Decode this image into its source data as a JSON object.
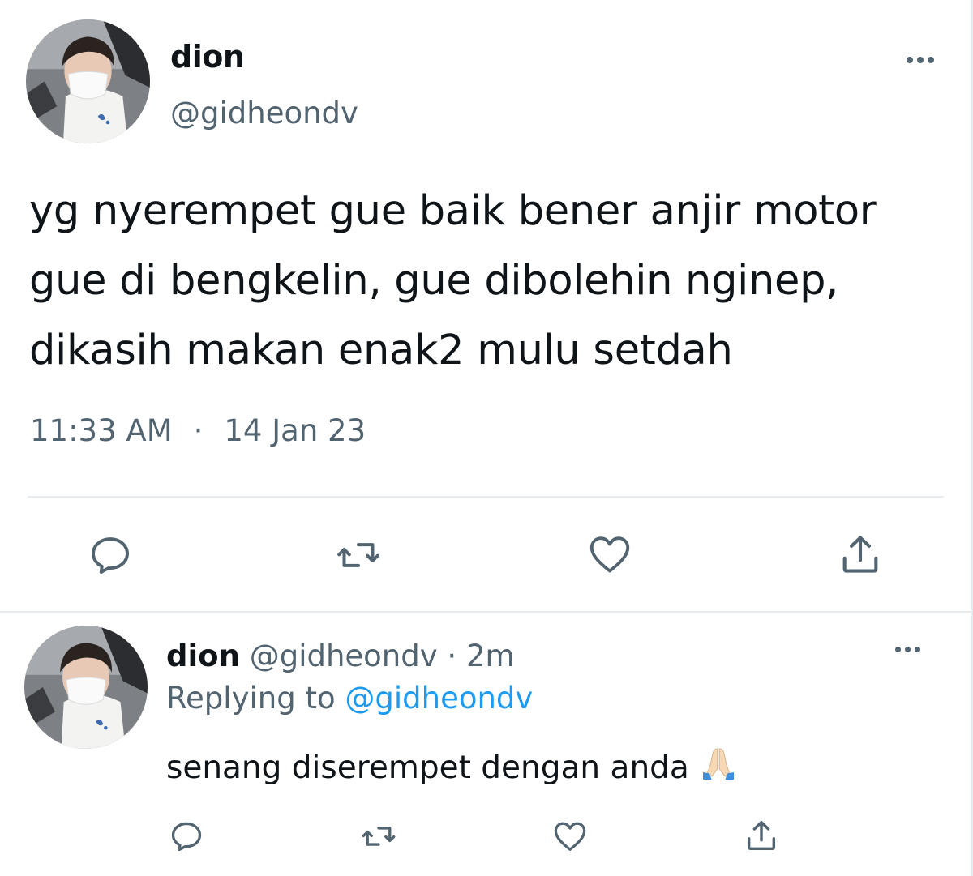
{
  "main_tweet": {
    "author_name": "dion",
    "author_handle": "@gidheondv",
    "text": "yg nyerempet gue baik bener anjir motor gue di bengkelin, gue dibolehin nginep, dikasih makan enak2 mulu setdah",
    "time": "11:33 AM",
    "separator": "·",
    "date": "14 Jan 23"
  },
  "reply": {
    "author_name": "dion",
    "author_handle": "@gidheondv",
    "separator": "·",
    "time_ago": "2m",
    "replying_prefix": "Replying to",
    "replying_to": "@gidheondv",
    "text": "senang diserempet dengan anda",
    "emoji_icon": "folded-hands-icon"
  },
  "icons": {
    "reply": "reply-icon",
    "retweet": "retweet-icon",
    "like": "heart-icon",
    "share": "share-icon",
    "more": "more-icon"
  },
  "colors": {
    "text_primary": "#0f1419",
    "text_secondary": "#536471",
    "link": "#1d9bf0",
    "divider": "#e6ecf0"
  }
}
